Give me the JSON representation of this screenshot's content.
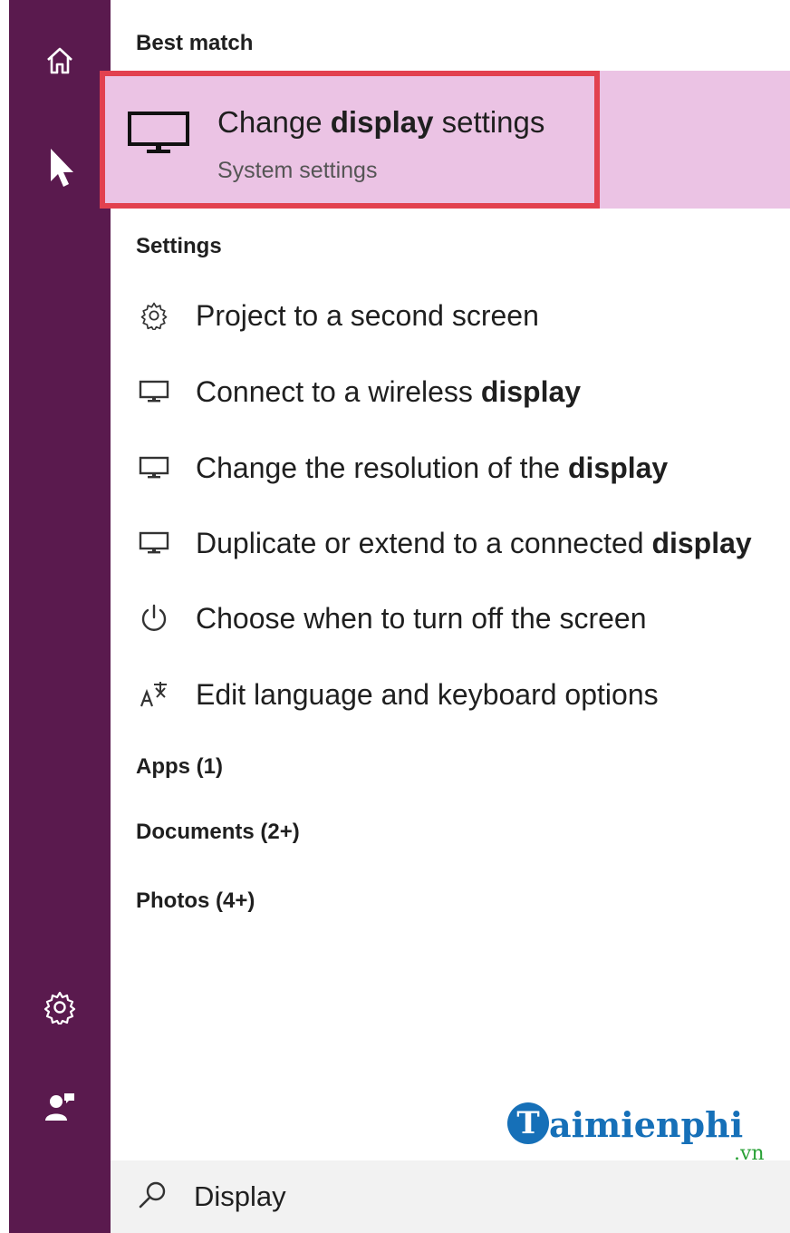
{
  "search": {
    "query": "Display"
  },
  "best_match": {
    "heading": "Best match",
    "title_prefix": "Change ",
    "title_bold": "display",
    "title_suffix": " settings",
    "subtitle": "System settings"
  },
  "settings": {
    "heading": "Settings",
    "items": [
      {
        "icon": "gear-icon",
        "prefix": "Project to a second screen",
        "bold": ""
      },
      {
        "icon": "monitor-icon",
        "prefix": "Connect to a wireless ",
        "bold": "display"
      },
      {
        "icon": "monitor-icon",
        "prefix": "Change the resolution of the ",
        "bold": "display"
      },
      {
        "icon": "monitor-icon",
        "prefix": "Duplicate or extend to a connected ",
        "bold": "display"
      },
      {
        "icon": "power-icon",
        "prefix": "Choose when to turn off the screen",
        "bold": ""
      },
      {
        "icon": "language-icon",
        "prefix": "Edit language and keyboard options",
        "bold": ""
      }
    ]
  },
  "categories": {
    "apps": "Apps (1)",
    "documents": "Documents (2+)",
    "photos": "Photos (4+)"
  },
  "watermark": {
    "badge": "T",
    "text": "aimienphi",
    "suffix": ".vn"
  },
  "colors": {
    "rail": "#5a1a4e",
    "highlight": "#ebc3e4",
    "red_box": "#e2414f"
  }
}
